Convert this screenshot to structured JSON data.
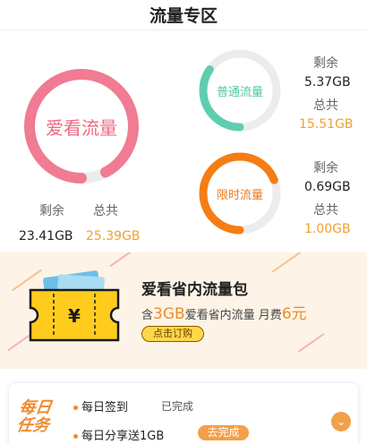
{
  "header": {
    "title": "流量专区"
  },
  "main_plan": {
    "name": "爱看流量",
    "remaining_label": "剩余",
    "total_label": "总共",
    "remaining_value": "23.41GB",
    "total_value": "25.39GB",
    "remaining_fraction": 0.922,
    "ring_color": "#f07b92"
  },
  "plans": [
    {
      "name": "普通流量",
      "remaining_label": "剩余",
      "total_label": "总共",
      "remaining_value": "5.37GB",
      "total_value": "15.51GB",
      "remaining_fraction": 0.346,
      "ring_color": "#60cdb0"
    },
    {
      "name": "限时流量",
      "remaining_label": "剩余",
      "total_label": "总共",
      "remaining_value": "0.69GB",
      "total_value": "1.00GB",
      "remaining_fraction": 0.69,
      "ring_color": "#f57d14"
    }
  ],
  "banner": {
    "title": "爱看省内流量包",
    "desc_prefix": "含",
    "desc_highlight_1": "3GB",
    "desc_middle": "爱看省内流量  月费",
    "desc_highlight_2": "6元",
    "button_label": "点击订购",
    "ticket_symbol": "¥"
  },
  "daily_tasks": {
    "logo_line_1": "每日",
    "logo_line_2": "任务",
    "items": [
      {
        "label": "每日签到",
        "status": "已完成"
      },
      {
        "label": "每日分享送1GB",
        "button": "去完成"
      }
    ],
    "expand_icon": "chevron-down-icon"
  },
  "colors": {
    "accent_orange": "#f08b2c",
    "pink": "#f07b92",
    "track_gray": "#ececec"
  }
}
